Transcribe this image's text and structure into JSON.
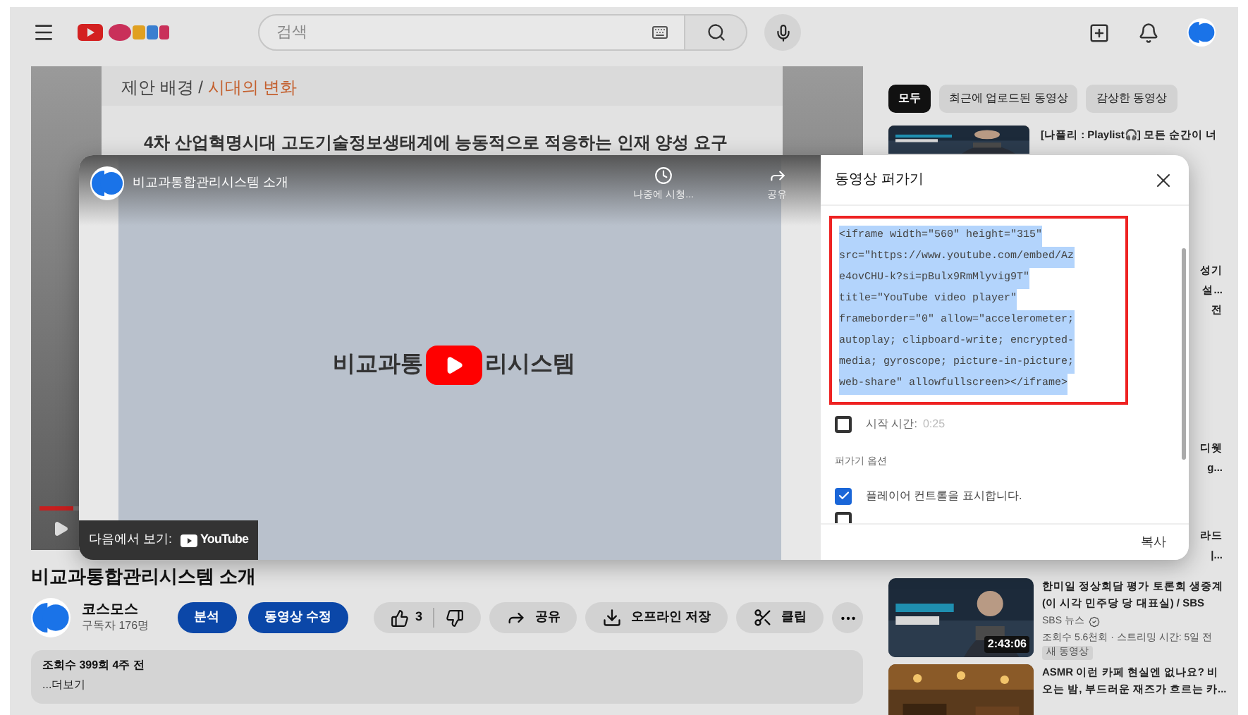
{
  "topbar": {
    "search": {
      "placeholder": "검색"
    }
  },
  "background_video": {
    "slide_heading": "제안 배경 / ",
    "slide_heading_accent": "시대의 변화",
    "slide_text": "4차 산업혁명시대 고도기술정보생태계에 능동적으로 적응하는 인재 양성 요구",
    "progress": {
      "level": 0.85
    }
  },
  "video_info": {
    "title": "비교과통합관리시스템 소개",
    "channel": "코스모스",
    "subscribers": "구독자 176명",
    "owner_buttons": [
      "분석",
      "동영상 수정"
    ],
    "likes": "3",
    "actions": [
      {
        "kind": "share",
        "label": "공유"
      },
      {
        "kind": "download",
        "label": "오프라인 저장"
      },
      {
        "kind": "clip",
        "label": "클립"
      }
    ],
    "description": {
      "stats": "조회수 399회  4주 전",
      "more": "...더보기"
    }
  },
  "sidebar": {
    "chips": [
      {
        "label": "모두",
        "selected": true
      },
      {
        "label": "최근에 업로드된 동영상",
        "selected": false
      },
      {
        "label": "감상한 동영상",
        "selected": false
      }
    ],
    "covered_items": [
      {
        "lines": [
          "[나플리 : Playlist🎧] 모든 순간이 너"
        ]
      },
      {
        "lines": [
          "성기",
          "설...",
          "전"
        ]
      },
      {
        "lines": [
          "디웻",
          "g..."
        ]
      },
      {
        "lines": [
          "라드",
          "|..."
        ]
      }
    ],
    "items": [
      {
        "title": "한미일 정상회담 평가 토론회 생중계 (이 시각 민주당 당 대표실) / SBS",
        "channel": "SBS 뉴스",
        "verified": true,
        "meta": "조회수 5.6천회 · 스트리밍 시간: 5일 전",
        "badge": "새 동영상",
        "duration": "2:43:06"
      },
      {
        "title": "ASMR 이런 카페 현실엔 없나요? 비 오는 밤, 부드러운 재즈가 흐르는 카..."
      }
    ]
  },
  "embed_dialog": {
    "player": {
      "title": "비교과통합관리시스템 소개",
      "watch_later": "나중에 시청...",
      "share": "공유",
      "slide_text_left": "비교과통",
      "slide_text_right": "리시스템",
      "watch_on": "다음에서 보기:",
      "watch_on_logo": "YouTube"
    },
    "title": "동영상 퍼가기",
    "code_lines": [
      "<iframe width=\"560\" height=\"315\"",
      "src=\"https://www.youtube.com/embed/Az",
      "e4ovCHU-k?si=pBulx9RmMlyvig9T\"",
      "title=\"YouTube video player\"",
      "frameborder=\"0\" allow=\"accelerometer;",
      "autoplay; clipboard-write; encrypted-",
      "media; gyroscope; picture-in-picture;",
      "web-share\" allowfullscreen></iframe>"
    ],
    "start_time": {
      "label": "시작 시간:",
      "value": "0:25",
      "checked": false
    },
    "options_heading": "퍼가기 옵션",
    "options": [
      {
        "label": "플레이어 컨트롤을 표시합니다.",
        "checked": true
      },
      {
        "checked": false
      }
    ],
    "copy_button": "복사"
  }
}
